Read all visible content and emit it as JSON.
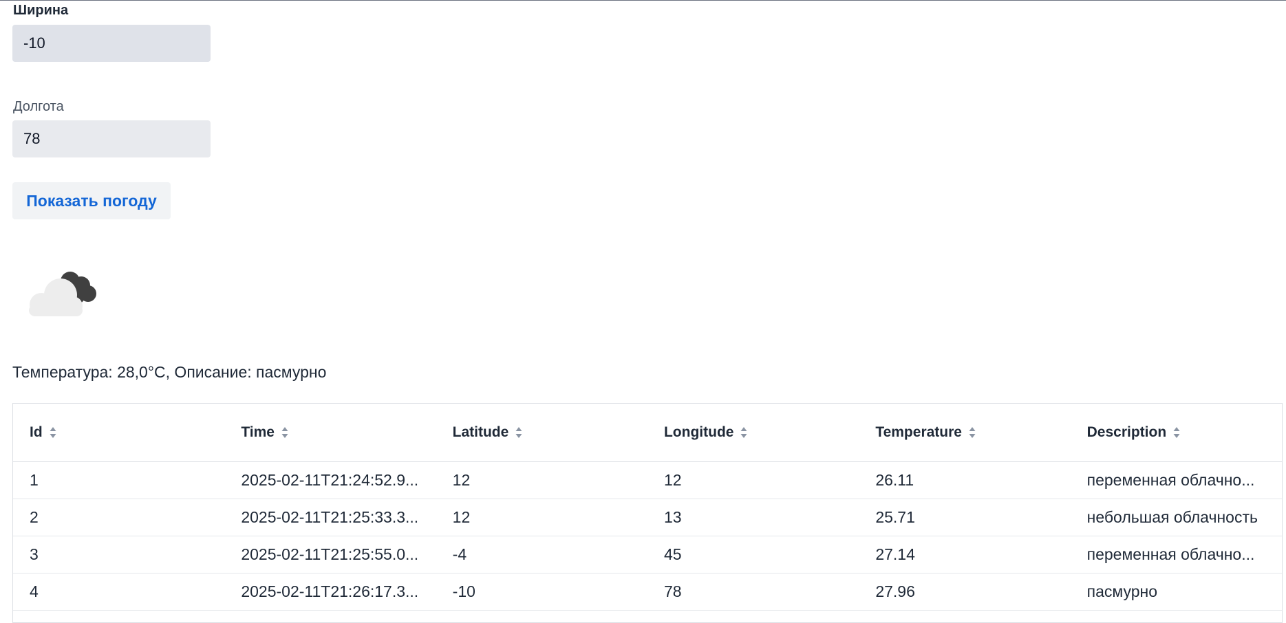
{
  "form": {
    "latitude_label": "Ширина",
    "latitude_value": "-10",
    "longitude_label": "Долгота",
    "longitude_value": "78",
    "submit_label": "Показать погоду"
  },
  "weather": {
    "icon": "overcast-clouds-icon",
    "summary": "Температура: 28,0°C, Описание: пасмурно"
  },
  "table": {
    "columns": [
      "Id",
      "Time",
      "Latitude",
      "Longitude",
      "Temperature",
      "Description"
    ],
    "rows": [
      [
        "1",
        "2025-02-11T21:24:52.9...",
        "12",
        "12",
        "26.11",
        "переменная облачно..."
      ],
      [
        "2",
        "2025-02-11T21:25:33.3...",
        "12",
        "13",
        "25.71",
        "небольшая облачность"
      ],
      [
        "3",
        "2025-02-11T21:25:55.0...",
        "-4",
        "45",
        "27.14",
        "переменная облачно..."
      ],
      [
        "4",
        "2025-02-11T21:26:17.3...",
        "-10",
        "78",
        "27.96",
        "пасмурно"
      ]
    ]
  },
  "colors": {
    "accent": "#1366d6",
    "input_bg": "#e8eaee",
    "border": "#dcdfe4"
  }
}
